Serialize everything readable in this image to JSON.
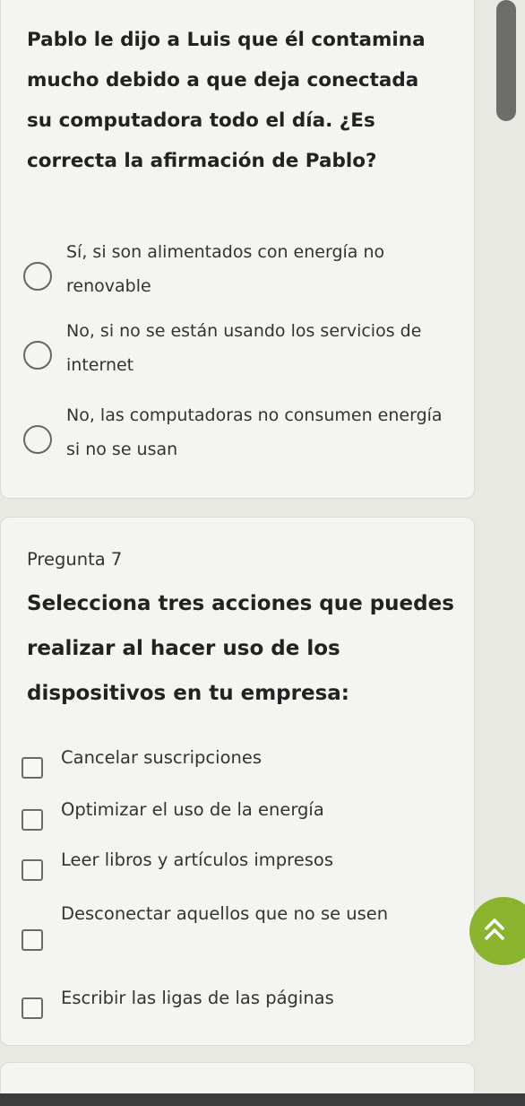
{
  "question6": {
    "text": "Pablo le dijo a Luis que él contamina mucho debido a que deja conectada su computadora todo el día. ¿Es correcta la afirmación de Pablo?",
    "options": [
      "Sí, si son alimentados con energía no renovable",
      "No, si no se están usando los servicios de internet",
      "No, las computadoras no consumen energía si no se usan"
    ]
  },
  "question7": {
    "number_label": "Pregunta 7",
    "text": "Selecciona tres acciones que puedes realizar al hacer uso de los dispositivos en tu empresa:",
    "options": [
      "Cancelar suscripciones",
      "Optimizar el uso de la energía",
      "Leer libros y artículos impresos",
      "Desconectar aquellos que no se usen",
      "Escribir las ligas de las páginas"
    ]
  },
  "scroll_top_button": {
    "icon": "double-chevron-up-icon",
    "glyph": "≪",
    "color": "#8ab32e"
  }
}
